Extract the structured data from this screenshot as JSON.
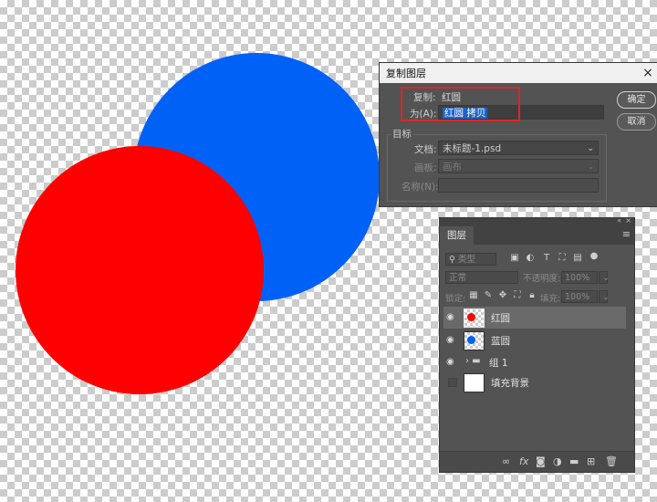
{
  "canvas": {
    "blue_circle_color": "#0061f7",
    "red_circle_color": "#ff0000"
  },
  "dialog": {
    "title": "复制图层",
    "close_icon": "×",
    "duplicate_label": "复制:",
    "duplicate_value": "红圆",
    "as_label": "为(A):",
    "as_value": "红圆 拷贝",
    "ok_label": "确定",
    "cancel_label": "取消",
    "destination_label": "目标",
    "document_label": "文档:",
    "document_value": "未标题-1.psd",
    "artboard_label": "画板:",
    "artboard_value": "画布",
    "name_label": "名称(N):",
    "name_value": "",
    "highlight_color": "#e02424"
  },
  "layers_panel": {
    "tab_label": "图层",
    "filter_placeholder": "类型",
    "blend_mode": "正常",
    "opacity_label": "不透明度:",
    "opacity_value": "100%",
    "lock_label": "锁定:",
    "fill_label": "填充:",
    "fill_value": "100%",
    "layers": [
      {
        "name": "红圆",
        "visible": true,
        "selected": true,
        "thumb_color": "#ff0000",
        "type": "pixel"
      },
      {
        "name": "蓝圆",
        "visible": true,
        "selected": false,
        "thumb_color": "#0061f7",
        "type": "pixel"
      },
      {
        "name": "组 1",
        "visible": true,
        "selected": false,
        "type": "group"
      },
      {
        "name": "填充背景",
        "visible": false,
        "selected": false,
        "type": "fill"
      }
    ],
    "bottom_icons": [
      "link-icon",
      "fx-icon",
      "mask-icon",
      "adjustment-icon",
      "folder-icon",
      "new-layer-icon",
      "trash-icon"
    ]
  }
}
